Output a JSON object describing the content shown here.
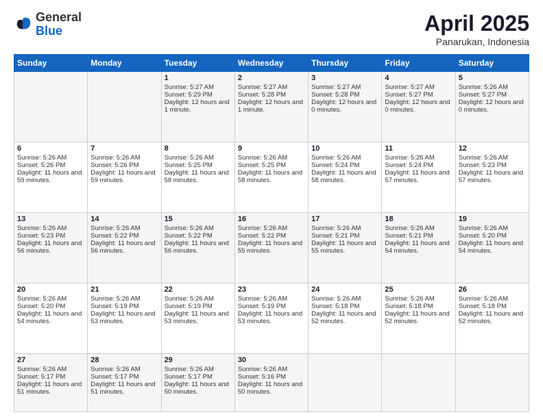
{
  "logo": {
    "general": "General",
    "blue": "Blue"
  },
  "header": {
    "month": "April 2025",
    "location": "Panarukan, Indonesia"
  },
  "weekdays": [
    "Sunday",
    "Monday",
    "Tuesday",
    "Wednesday",
    "Thursday",
    "Friday",
    "Saturday"
  ],
  "weeks": [
    [
      {
        "day": "",
        "empty": true
      },
      {
        "day": "",
        "empty": true
      },
      {
        "day": "1",
        "sunrise": "5:27 AM",
        "sunset": "5:29 PM",
        "daylight": "12 hours and 1 minute."
      },
      {
        "day": "2",
        "sunrise": "5:27 AM",
        "sunset": "5:28 PM",
        "daylight": "12 hours and 1 minute."
      },
      {
        "day": "3",
        "sunrise": "5:27 AM",
        "sunset": "5:28 PM",
        "daylight": "12 hours and 0 minutes."
      },
      {
        "day": "4",
        "sunrise": "5:27 AM",
        "sunset": "5:27 PM",
        "daylight": "12 hours and 0 minutes."
      },
      {
        "day": "5",
        "sunrise": "5:26 AM",
        "sunset": "5:27 PM",
        "daylight": "12 hours and 0 minutes."
      }
    ],
    [
      {
        "day": "6",
        "sunrise": "5:26 AM",
        "sunset": "5:26 PM",
        "daylight": "11 hours and 59 minutes."
      },
      {
        "day": "7",
        "sunrise": "5:26 AM",
        "sunset": "5:26 PM",
        "daylight": "11 hours and 59 minutes."
      },
      {
        "day": "8",
        "sunrise": "5:26 AM",
        "sunset": "5:25 PM",
        "daylight": "11 hours and 58 minutes."
      },
      {
        "day": "9",
        "sunrise": "5:26 AM",
        "sunset": "5:25 PM",
        "daylight": "11 hours and 58 minutes."
      },
      {
        "day": "10",
        "sunrise": "5:26 AM",
        "sunset": "5:24 PM",
        "daylight": "11 hours and 58 minutes."
      },
      {
        "day": "11",
        "sunrise": "5:26 AM",
        "sunset": "5:24 PM",
        "daylight": "11 hours and 57 minutes."
      },
      {
        "day": "12",
        "sunrise": "5:26 AM",
        "sunset": "5:23 PM",
        "daylight": "11 hours and 57 minutes."
      }
    ],
    [
      {
        "day": "13",
        "sunrise": "5:26 AM",
        "sunset": "5:23 PM",
        "daylight": "11 hours and 56 minutes."
      },
      {
        "day": "14",
        "sunrise": "5:26 AM",
        "sunset": "5:22 PM",
        "daylight": "11 hours and 56 minutes."
      },
      {
        "day": "15",
        "sunrise": "5:26 AM",
        "sunset": "5:22 PM",
        "daylight": "11 hours and 56 minutes."
      },
      {
        "day": "16",
        "sunrise": "5:26 AM",
        "sunset": "5:22 PM",
        "daylight": "11 hours and 55 minutes."
      },
      {
        "day": "17",
        "sunrise": "5:26 AM",
        "sunset": "5:21 PM",
        "daylight": "11 hours and 55 minutes."
      },
      {
        "day": "18",
        "sunrise": "5:26 AM",
        "sunset": "5:21 PM",
        "daylight": "11 hours and 54 minutes."
      },
      {
        "day": "19",
        "sunrise": "5:26 AM",
        "sunset": "5:20 PM",
        "daylight": "11 hours and 54 minutes."
      }
    ],
    [
      {
        "day": "20",
        "sunrise": "5:26 AM",
        "sunset": "5:20 PM",
        "daylight": "11 hours and 54 minutes."
      },
      {
        "day": "21",
        "sunrise": "5:26 AM",
        "sunset": "5:19 PM",
        "daylight": "11 hours and 53 minutes."
      },
      {
        "day": "22",
        "sunrise": "5:26 AM",
        "sunset": "5:19 PM",
        "daylight": "11 hours and 53 minutes."
      },
      {
        "day": "23",
        "sunrise": "5:26 AM",
        "sunset": "5:19 PM",
        "daylight": "11 hours and 53 minutes."
      },
      {
        "day": "24",
        "sunrise": "5:26 AM",
        "sunset": "5:18 PM",
        "daylight": "11 hours and 52 minutes."
      },
      {
        "day": "25",
        "sunrise": "5:26 AM",
        "sunset": "5:18 PM",
        "daylight": "11 hours and 52 minutes."
      },
      {
        "day": "26",
        "sunrise": "5:26 AM",
        "sunset": "5:18 PM",
        "daylight": "11 hours and 52 minutes."
      }
    ],
    [
      {
        "day": "27",
        "sunrise": "5:26 AM",
        "sunset": "5:17 PM",
        "daylight": "11 hours and 51 minutes."
      },
      {
        "day": "28",
        "sunrise": "5:26 AM",
        "sunset": "5:17 PM",
        "daylight": "11 hours and 51 minutes."
      },
      {
        "day": "29",
        "sunrise": "5:26 AM",
        "sunset": "5:17 PM",
        "daylight": "11 hours and 50 minutes."
      },
      {
        "day": "30",
        "sunrise": "5:26 AM",
        "sunset": "5:16 PM",
        "daylight": "11 hours and 50 minutes."
      },
      {
        "day": "",
        "empty": true
      },
      {
        "day": "",
        "empty": true
      },
      {
        "day": "",
        "empty": true
      }
    ]
  ]
}
